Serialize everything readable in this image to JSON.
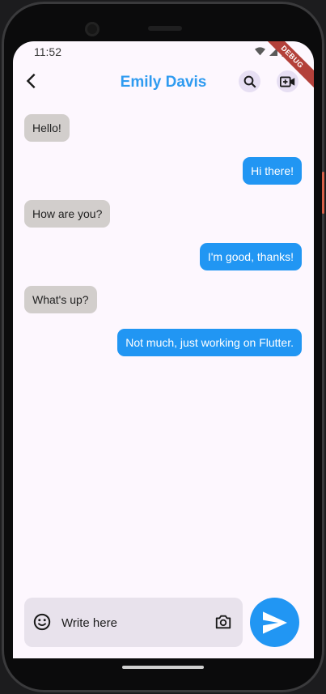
{
  "status_bar": {
    "time": "11:52",
    "icons": [
      "wifi-icon",
      "signal-icon",
      "battery-icon"
    ]
  },
  "debug_banner": "DEBUG",
  "app_bar": {
    "back_icon": "back-arrow-icon",
    "title": "Emily Davis",
    "actions": [
      {
        "name": "search",
        "icon": "search-icon"
      },
      {
        "name": "video-call",
        "icon": "video-call-icon"
      }
    ]
  },
  "messages": [
    {
      "text": "Hello!",
      "direction": "incoming"
    },
    {
      "text": "Hi there!",
      "direction": "outgoing"
    },
    {
      "text": "How are you?",
      "direction": "incoming"
    },
    {
      "text": "I'm good, thanks!",
      "direction": "outgoing"
    },
    {
      "text": "What's up?",
      "direction": "incoming"
    },
    {
      "text": "Not much, just working on Flutter.",
      "direction": "outgoing"
    }
  ],
  "composer": {
    "emoji_icon": "emoji-icon",
    "placeholder": "Write here",
    "value": "",
    "camera_icon": "camera-icon",
    "send_icon": "send-icon"
  },
  "colors": {
    "accent": "#2196f3",
    "title": "#2f9bf0",
    "incoming_bubble": "#d2cecc",
    "outgoing_bubble": "#2196f3",
    "background": "#fdf7fe",
    "composer_bg": "#e8e2ec"
  }
}
